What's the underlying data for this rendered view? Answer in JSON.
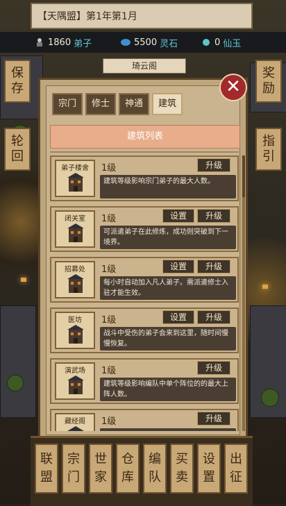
{
  "header": {
    "title": "【天隅盟】第1年第1月"
  },
  "resources": [
    {
      "value": "1860",
      "label": "弟子",
      "icon": "disciple-icon"
    },
    {
      "value": "5500",
      "label": "灵石",
      "icon": "spirit-stone-icon"
    },
    {
      "value": "0",
      "label": "仙玉",
      "icon": "jade-icon"
    }
  ],
  "side": {
    "left": [
      {
        "label": "保存",
        "chars": [
          "保",
          "存"
        ]
      },
      {
        "label": "轮回",
        "chars": [
          "轮",
          "回"
        ]
      }
    ],
    "right": [
      {
        "label": "奖励",
        "chars": [
          "奖",
          "励"
        ]
      },
      {
        "label": "指引",
        "chars": [
          "指",
          "引"
        ]
      }
    ]
  },
  "pavilion_label": "琦云阁",
  "panel": {
    "tabs": [
      "宗门",
      "修士",
      "神通",
      "建筑"
    ],
    "active_tab": "建筑",
    "list_title": "建筑列表",
    "close_label": "✕",
    "buildings": [
      {
        "name": "弟子楼舍",
        "level": "1级",
        "buttons": [
          "升级"
        ],
        "desc": "建筑等级影响宗门弟子的最大人数。"
      },
      {
        "name": "闭关室",
        "level": "1级",
        "buttons": [
          "设置",
          "升级"
        ],
        "desc": "可派遣弟子在此修炼，成功则突破到下一境界。"
      },
      {
        "name": "招募处",
        "level": "1级",
        "buttons": [
          "设置",
          "升级"
        ],
        "desc": "每小时自动加入凡人弟子。需派遣修士入驻才能生效。"
      },
      {
        "name": "医坊",
        "level": "1级",
        "buttons": [
          "设置",
          "升级"
        ],
        "desc": "战斗中受伤的弟子会来到这里，随时间慢慢恢复。"
      },
      {
        "name": "演武场",
        "level": "1级",
        "buttons": [
          "升级"
        ],
        "desc": "建筑等级影响编队中单个阵位的的最大上阵人数。"
      },
      {
        "name": "藏经阁",
        "level": "1级",
        "buttons": [
          "升级"
        ],
        "desc": ""
      }
    ]
  },
  "bottom_nav": [
    {
      "label": "联盟",
      "chars": [
        "联",
        "盟"
      ]
    },
    {
      "label": "宗门",
      "chars": [
        "宗",
        "门"
      ]
    },
    {
      "label": "世家",
      "chars": [
        "世",
        "家"
      ]
    },
    {
      "label": "仓库",
      "chars": [
        "仓",
        "库"
      ]
    },
    {
      "label": "编队",
      "chars": [
        "编",
        "队"
      ]
    },
    {
      "label": "买卖",
      "chars": [
        "买",
        "卖"
      ]
    },
    {
      "label": "设置",
      "chars": [
        "设",
        "置"
      ]
    },
    {
      "label": "出征",
      "chars": [
        "出",
        "征"
      ]
    }
  ]
}
